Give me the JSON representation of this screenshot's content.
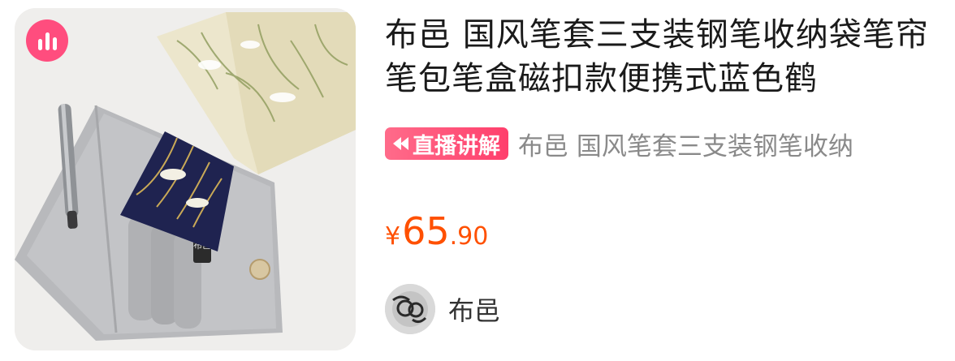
{
  "product": {
    "title": "布邑 国风笔套三支装钢笔收纳袋笔帘笔包笔盒磁扣款便携式蓝色鹤",
    "image_alt": "grey suede pen roll with crane-pattern fabric flap",
    "live_tag": "直播讲解",
    "live_desc": "布邑 国风笔套三支装钢笔收纳",
    "price": {
      "currency": "¥",
      "integer": "65",
      "decimal": ".90"
    },
    "shop_name": "布邑"
  },
  "colors": {
    "price": "#ff5000",
    "live_tag": "#ff4a74",
    "hot_badge": "#ff4d7e",
    "title": "#1a1a1a",
    "secondary": "#8a8a8a"
  },
  "icons": {
    "hot": "bar-chart-icon",
    "live": "rewind-icon"
  }
}
